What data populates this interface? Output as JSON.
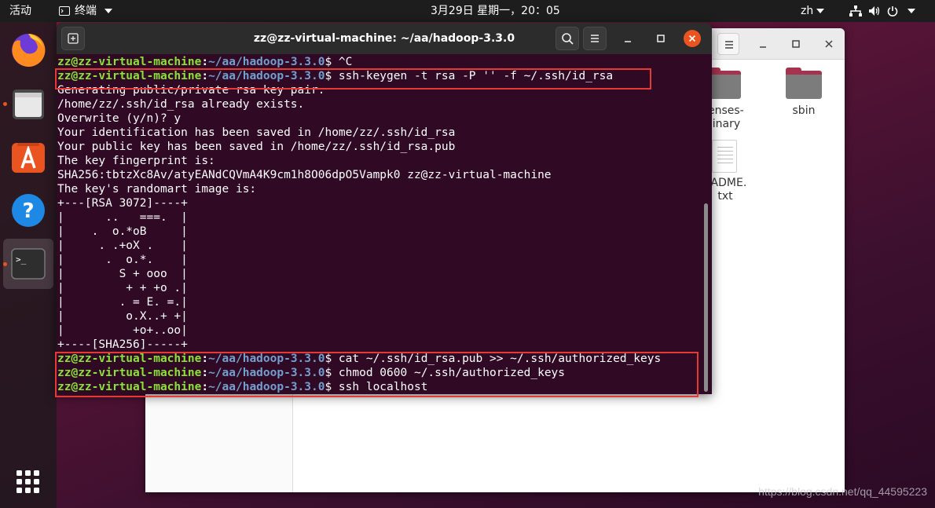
{
  "topbar": {
    "activities": "活动",
    "app_name": "终端",
    "clock": "3月29日 星期一，20：05",
    "language": "zh"
  },
  "dock": {
    "items": [
      "firefox-icon",
      "files-icon",
      "software-icon",
      "help-icon",
      "terminal-icon",
      "app-grid-icon"
    ]
  },
  "file_manager": {
    "items": [
      {
        "label_line1": "censes-",
        "label_line2": "binary"
      },
      {
        "label_line1": "sbin",
        "label_line2": ""
      },
      {
        "label_line1": "EADME.",
        "label_line2": "txt"
      }
    ]
  },
  "terminal": {
    "title": "zz@zz-virtual-machine: ~/aa/hadoop-3.3.0",
    "prompt_user": "zz@zz-virtual-machine",
    "prompt_sep": ":",
    "prompt_path": "~/aa/hadoop-3.3.0",
    "prompt_end": "$",
    "lines": [
      {
        "type": "cmd",
        "cmd": " ^C"
      },
      {
        "type": "cmd",
        "cmd": " ssh-keygen -t rsa -P '' -f ~/.ssh/id_rsa"
      },
      {
        "type": "out",
        "text": "Generating public/private rsa key pair."
      },
      {
        "type": "out",
        "text": "/home/zz/.ssh/id_rsa already exists."
      },
      {
        "type": "out",
        "text": "Overwrite (y/n)? y"
      },
      {
        "type": "out",
        "text": "Your identification has been saved in /home/zz/.ssh/id_rsa"
      },
      {
        "type": "out",
        "text": "Your public key has been saved in /home/zz/.ssh/id_rsa.pub"
      },
      {
        "type": "out",
        "text": "The key fingerprint is:"
      },
      {
        "type": "out",
        "text": "SHA256:tbtzXc8Av/atyEANdCQVmA4K9cm1h8O06dpO5Vampk0 zz@zz-virtual-machine"
      },
      {
        "type": "out",
        "text": "The key's randomart image is:"
      },
      {
        "type": "out",
        "text": "+---[RSA 3072]----+"
      },
      {
        "type": "out",
        "text": "|      ..   ===.  |"
      },
      {
        "type": "out",
        "text": "|    .  o.*oB     |"
      },
      {
        "type": "out",
        "text": "|     . .+oX .    |"
      },
      {
        "type": "out",
        "text": "|      .  o.*.    |"
      },
      {
        "type": "out",
        "text": "|        S + ooo  |"
      },
      {
        "type": "out",
        "text": "|         + + +o .|"
      },
      {
        "type": "out",
        "text": "|        . = E. =.|"
      },
      {
        "type": "out",
        "text": "|         o.X..+ +|"
      },
      {
        "type": "out",
        "text": "|          +o+..oo|"
      },
      {
        "type": "out",
        "text": "+----[SHA256]-----+"
      },
      {
        "type": "cmd",
        "cmd": " cat ~/.ssh/id_rsa.pub >> ~/.ssh/authorized_keys"
      },
      {
        "type": "cmd",
        "cmd": " chmod 0600 ~/.ssh/authorized_keys"
      },
      {
        "type": "cmd",
        "cmd": " ssh localhost"
      }
    ]
  },
  "watermark": "https://blog.csdn.net/qq_44595223",
  "colors": {
    "prompt_user": "#8ae234",
    "prompt_path": "#729fcf",
    "terminal_bg": "#300a24",
    "highlight_box": "#e53935",
    "accent": "#e95420"
  }
}
